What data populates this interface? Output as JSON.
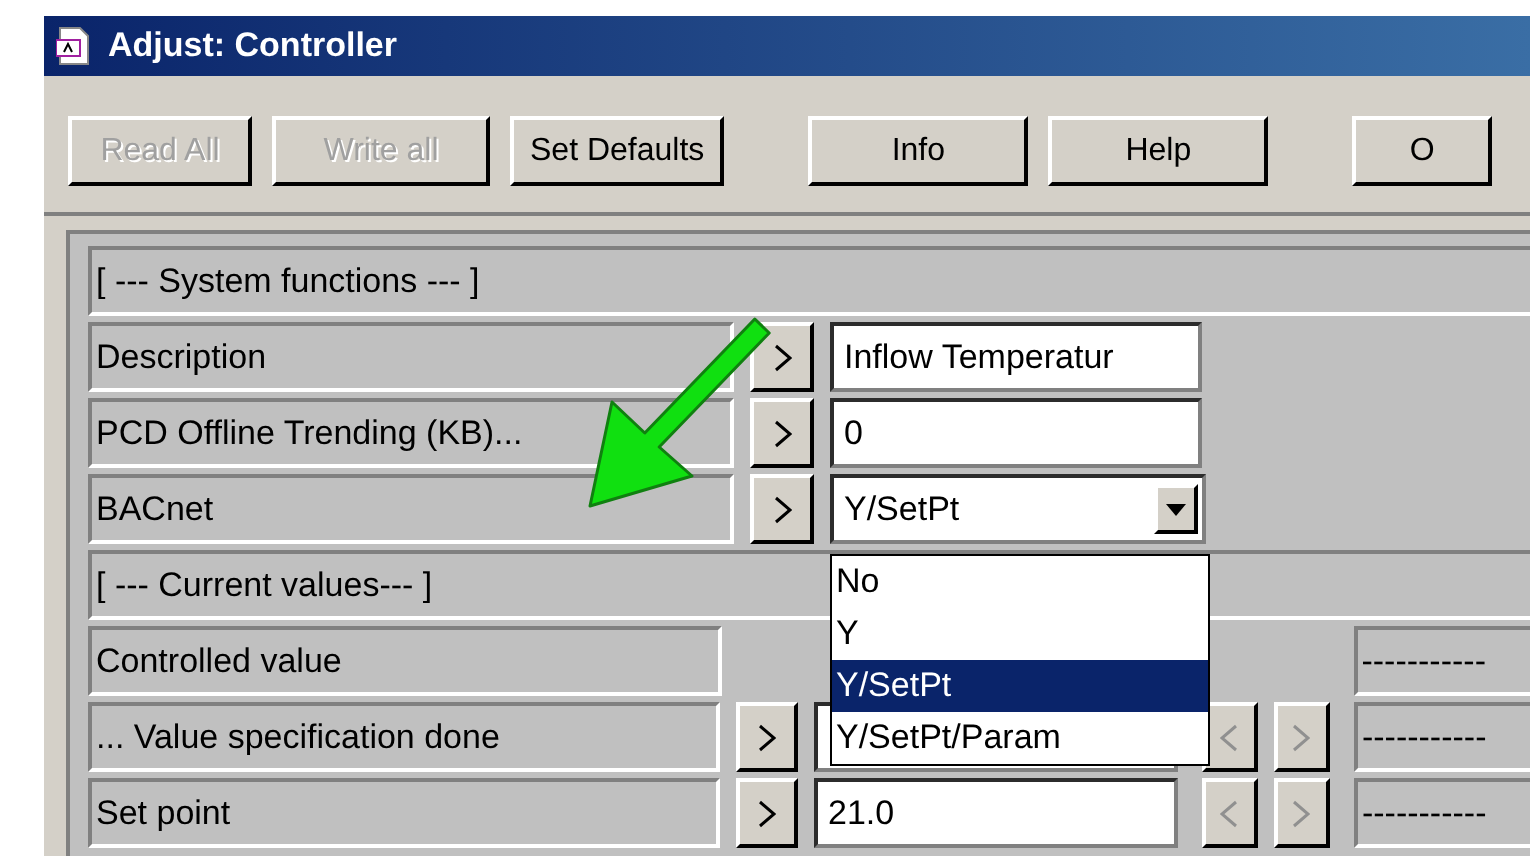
{
  "window": {
    "title": "Adjust: Controller"
  },
  "toolbar": [
    {
      "label": "Read All",
      "disabled": true
    },
    {
      "label": "Write all",
      "disabled": true
    },
    {
      "label": "Set Defaults",
      "disabled": false
    },
    {
      "label": "Info",
      "disabled": false
    },
    {
      "label": "Help",
      "disabled": false
    },
    {
      "label": "O",
      "disabled": false
    }
  ],
  "rows": [
    {
      "kind": "header",
      "label": "[ --- System functions --- ]"
    },
    {
      "kind": "field",
      "label": "Description",
      "arrow": true,
      "value": "Inflow Temperatur",
      "stepper": false
    },
    {
      "kind": "field",
      "label": "PCD Offline Trending (KB)...",
      "arrow": true,
      "value": "0",
      "stepper": false
    },
    {
      "kind": "select",
      "label": "BACnet",
      "arrow": true,
      "value": "Y/SetPt",
      "stepper": false,
      "open": true,
      "options": [
        {
          "label": "No",
          "selected": false
        },
        {
          "label": "Y",
          "selected": false
        },
        {
          "label": "Y/SetPt",
          "selected": true
        },
        {
          "label": "Y/SetPt/Param",
          "selected": false
        }
      ]
    },
    {
      "kind": "header",
      "label": "[ --- Current values--- ]"
    },
    {
      "kind": "readout",
      "label": "Controlled value",
      "arrow": false,
      "stepper": false,
      "display": "-----------"
    },
    {
      "kind": "field",
      "label": "... Value specification done",
      "arrow": true,
      "stepper": true,
      "display": "-----------"
    },
    {
      "kind": "field",
      "label": "Set point",
      "arrow": true,
      "value": "21.0",
      "stepper": true,
      "display": "-----------"
    }
  ]
}
